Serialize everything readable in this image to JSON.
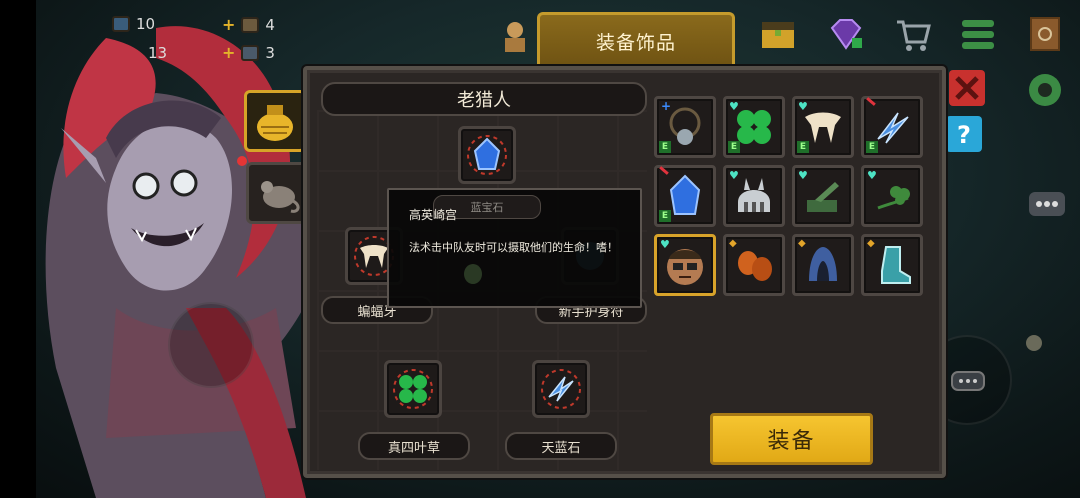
{
  "hud": {
    "stat1_value": "10",
    "stat2_value": "13",
    "resource1_count": "4",
    "resource2_count": "3",
    "plus": "+"
  },
  "modal": {
    "title": "装备饰品",
    "character_name": "老猎人",
    "equip_button": "装备",
    "slots": [
      {
        "label": "蝙蝠牙"
      },
      {
        "label": "新手护身符"
      },
      {
        "label": "真四叶草"
      },
      {
        "label": "天蓝石"
      }
    ],
    "tooltip": {
      "author": "高英崎宫",
      "item_name": "蓝宝石",
      "description": "法术击中队友时可以摄取他们的生命！嗜！"
    },
    "inventory_badge": "E"
  },
  "colors": {
    "accent_gold": "#e1a916",
    "panel_bg": "#2b2624",
    "heart": "#4de3c4",
    "equip_badge": "#1f6f2a"
  },
  "icons": [
    "skull-necklace-icon",
    "four-leaf-clover-icon",
    "bat-fang-icon",
    "sky-blue-stone-icon",
    "sapphire-icon",
    "spiked-helmet-icon",
    "cannon-icon",
    "sprout-icon",
    "glasses-face-icon",
    "boxing-gloves-icon",
    "hood-icon",
    "boot-icon"
  ]
}
